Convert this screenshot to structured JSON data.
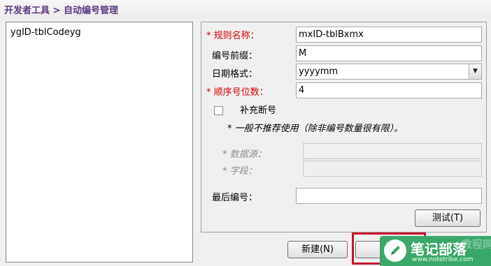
{
  "header": {
    "breadcrumb": "开发者工具 > 自动编号管理"
  },
  "code_list": {
    "items": [
      "ygID-tblCodeyg"
    ]
  },
  "form": {
    "rule_name": {
      "label": "规则名称：",
      "required_mark": "*",
      "value": "mxID-tblBxmx"
    },
    "prefix": {
      "label": "编号前缀：",
      "value": "M"
    },
    "date_format": {
      "label": "日期格式：",
      "value": "yyyymm"
    },
    "seq_digits": {
      "label": "顺序号位数：",
      "required_mark": "*",
      "value": "4"
    },
    "fill_gap": {
      "label": "补充断号",
      "checked": false
    },
    "note": "* 一般不推荐使用（除非编号数量很有限）。",
    "data_source": {
      "label": "* 数据源：",
      "value": ""
    },
    "field": {
      "label": "* 字段：",
      "value": ""
    },
    "last_number": {
      "label": "最后编号：",
      "value": ""
    },
    "test_button": "测试(T)"
  },
  "footer": {
    "new_button": "新建(N)",
    "save_button": "保"
  },
  "watermark": {
    "title": "笔记部落",
    "url": "www.notetribe.com",
    "faded_text": "教程网"
  },
  "colors": {
    "title": "#5b3a7e",
    "required": "#d40000",
    "highlight": "#c8102e",
    "watermark_bg": "#3aa86b"
  }
}
